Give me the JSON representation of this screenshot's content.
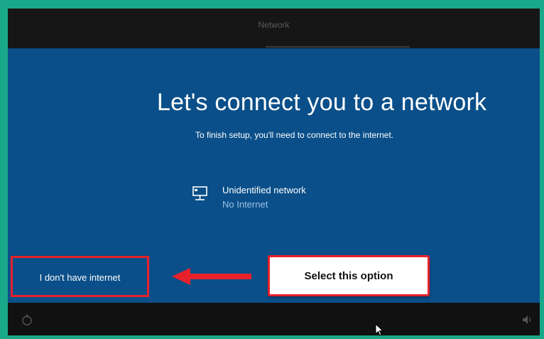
{
  "top_bar": {
    "title": "Network"
  },
  "main": {
    "heading": "Let's connect you to a network",
    "subheading": "To finish setup, you'll need to connect to the internet.",
    "network": {
      "name": "Unidentified network",
      "status": "No Internet",
      "icon": "wired-network-icon"
    },
    "no_internet_link": "I don't have internet"
  },
  "annotation": {
    "callout_text": "Select this option",
    "highlight_color": "#e8212b",
    "arrow_color": "#e8212b"
  },
  "bottom_bar": {
    "left_icon": "accessibility-icon",
    "right_icon": "volume-icon"
  },
  "colors": {
    "frame": "#1aa88a",
    "oobe_blue": "#0a4f89",
    "bar": "#161616"
  }
}
